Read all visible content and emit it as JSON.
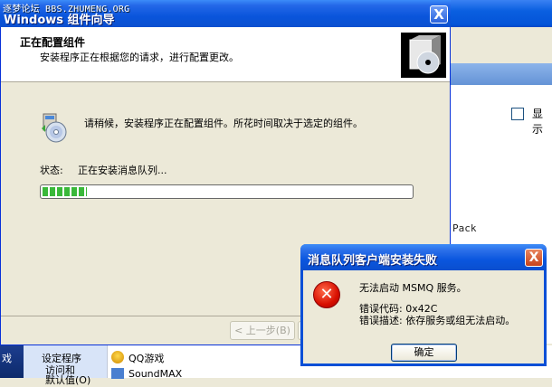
{
  "forum_watermark": "逐梦论坛 BBS.ZHUMENG.ORG",
  "wizard": {
    "title": "Windows 组件向导",
    "close_label": "X",
    "header_title": "正在配置组件",
    "header_subtitle": "安装程序正在根据您的请求，进行配置更改。",
    "message": "请稍候，安装程序正在配置组件。所花时间取决于选定的组件。",
    "status_label": "状态:",
    "status_value": "正在安装消息队列...",
    "progress_fraction": 0.12,
    "back_label": "< 上一步(B)"
  },
  "error_dialog": {
    "title": "消息队列客户端安装失败",
    "close_label": "X",
    "line1": "无法启动 MSMQ 服务。",
    "line2": "错误代码: 0x42C",
    "line3": "错误描述: 依存服务或组无法启动。",
    "ok_label": "确定"
  },
  "background_window": {
    "show_label": "显示",
    "pack_text": "Pack"
  },
  "bottom_strip": {
    "dark_label": "戏",
    "selected_line1": "设定程序",
    "selected_line2": "访问和",
    "selected_line3": "默认值(O)",
    "item1": "QQ游戏",
    "item2": "SoundMAX"
  },
  "colors": {
    "title_blue": "#0a55dc",
    "progress_green": "#3ab83a",
    "error_red": "#d80f00"
  }
}
